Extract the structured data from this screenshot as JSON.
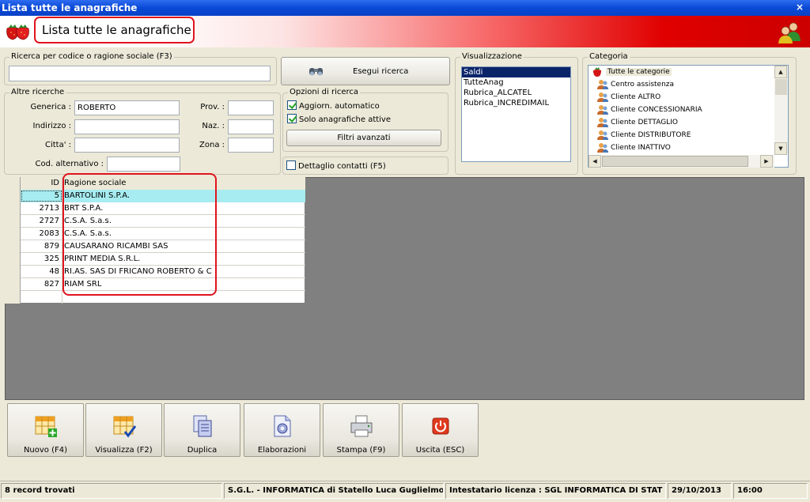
{
  "window": {
    "title": "Lista tutte le anagrafiche",
    "close_glyph": "×"
  },
  "header": {
    "title": "Lista tutte le anagrafiche"
  },
  "search": {
    "group_label": "Ricerca per codice o ragione sociale (F3)",
    "value": "",
    "button_label": "Esegui ricerca"
  },
  "other_search": {
    "group_label": "Altre ricerche",
    "generica_label": "Generica :",
    "generica_value": "ROBERTO",
    "indirizzo_label": "Indirizzo :",
    "indirizzo_value": "",
    "citta_label": "Citta' :",
    "citta_value": "",
    "cod_alt_label": "Cod. alternativo :",
    "cod_alt_value": "",
    "prov_label": "Prov. :",
    "prov_value": "",
    "naz_label": "Naz. :",
    "naz_value": "",
    "zona_label": "Zona :",
    "zona_value": ""
  },
  "options": {
    "group_label": "Opzioni di ricerca",
    "auto_update_label": "Aggiorn. automatico",
    "auto_update_checked": true,
    "active_only_label": "Solo anagrafiche attive",
    "active_only_checked": true,
    "advanced_filters_label": "Filtri avanzati",
    "contact_detail_label": "Dettaglio contatti (F5)",
    "contact_detail_checked": false
  },
  "view": {
    "group_label": "Visualizzazione",
    "items": [
      "Saldi",
      "TutteAnag",
      "Rubrica_ALCATEL",
      "Rubrica_INCREDIMAIL"
    ],
    "selected": "Saldi"
  },
  "category": {
    "group_label": "Categoria",
    "root": "Tutte le categorie",
    "items": [
      "Centro assistenza",
      "Cliente ALTRO",
      "Cliente CONCESSIONARIA",
      "Cliente DETTAGLIO",
      "Cliente DISTRIBUTORE",
      "Cliente INATTIVO"
    ]
  },
  "grid": {
    "columns": [
      "ID",
      "Ragione sociale"
    ],
    "rows": [
      {
        "id": "5",
        "name": "BARTOLINI S.P.A."
      },
      {
        "id": "2713",
        "name": "BRT S.P.A."
      },
      {
        "id": "2727",
        "name": "C.S.A. S.a.s."
      },
      {
        "id": "2083",
        "name": "C.S.A. S.a.s."
      },
      {
        "id": "879",
        "name": "CAUSARANO RICAMBI SAS"
      },
      {
        "id": "325",
        "name": "PRINT MEDIA S.R.L."
      },
      {
        "id": "48",
        "name": "RI.AS. SAS DI FRICANO ROBERTO & C"
      },
      {
        "id": "827",
        "name": "RIAM SRL"
      }
    ]
  },
  "toolbar": {
    "buttons": [
      {
        "label": "Nuovo (F4)",
        "icon": "new-grid-icon"
      },
      {
        "label": "Visualizza (F2)",
        "icon": "view-grid-icon"
      },
      {
        "label": "Duplica",
        "icon": "duplicate-icon"
      },
      {
        "label": "Elaborazioni",
        "icon": "process-icon"
      },
      {
        "label": "Stampa (F9)",
        "icon": "printer-icon"
      },
      {
        "label": "Uscita (ESC)",
        "icon": "exit-icon"
      }
    ]
  },
  "status": {
    "records": "8 record trovati",
    "company": "S.G.L. - INFORMATICA di Statello Luca Guglielmo",
    "license": "Intestatario licenza : SGL  INFORMATICA DI STAT",
    "date": "29/10/2013",
    "time": "16:00"
  },
  "colors": {
    "accent_red": "#e0141e",
    "selection": "#0a246a",
    "grid_highlight": "#a6ecf0"
  }
}
